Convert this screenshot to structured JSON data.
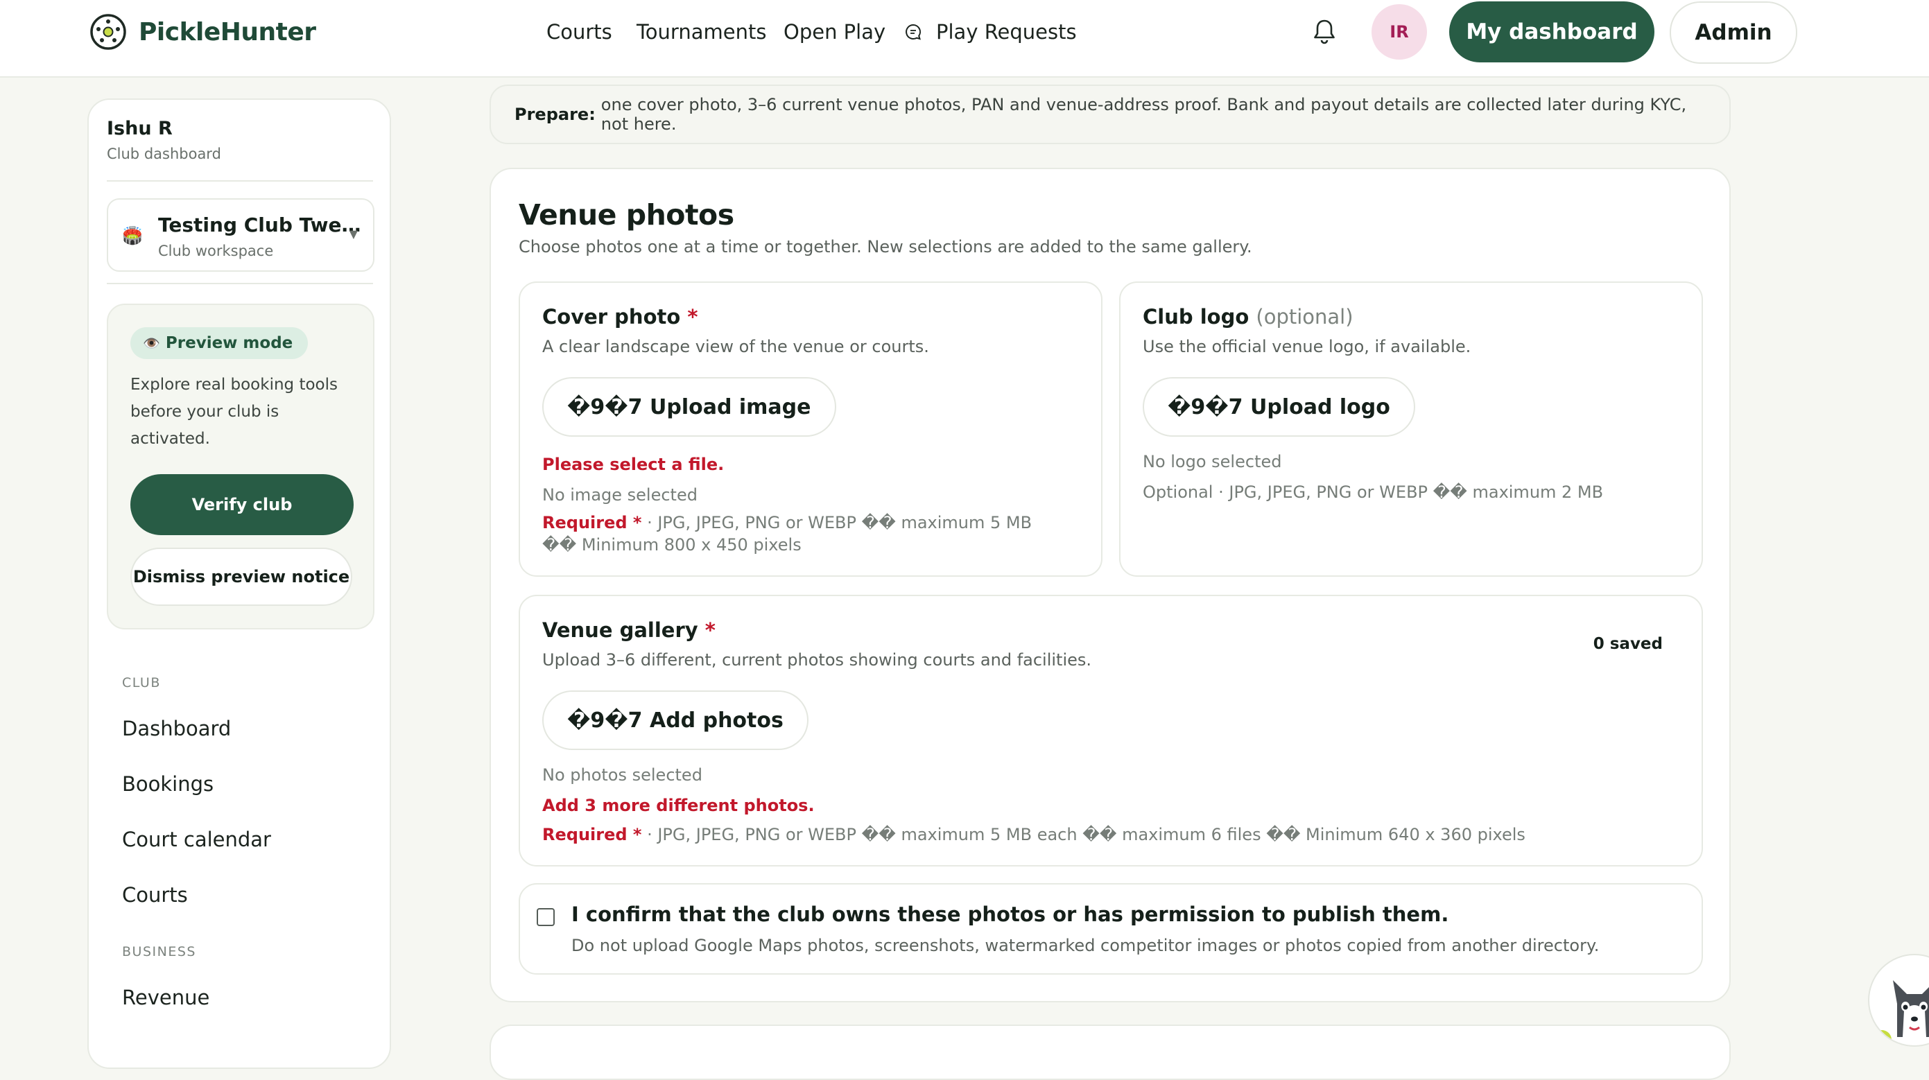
{
  "brand": {
    "name": "PickleHunter"
  },
  "nav": {
    "courts": "Courts",
    "tournaments": "Tournaments",
    "open_play": "Open Play",
    "play_requests": "Play Requests"
  },
  "header": {
    "avatar_initials": "IR",
    "dashboard_label": "My dashboard",
    "admin_label": "Admin"
  },
  "sidebar": {
    "user_name": "Ishu R",
    "user_role": "Club dashboard",
    "club_name": "Testing Club Twe…",
    "club_sub": "Club workspace",
    "preview_badge": "Preview mode",
    "preview_text": "Explore real booking tools before your club is activated.",
    "verify_label": "Verify club",
    "dismiss_label": "Dismiss preview notice",
    "section_club": "CLUB",
    "section_business": "BUSINESS",
    "items": [
      "Dashboard",
      "Bookings",
      "Court calendar",
      "Courts"
    ],
    "business_items": [
      "Revenue"
    ]
  },
  "prepare": {
    "label": "Prepare:",
    "text": "one cover photo, 3–6 current venue photos, PAN and venue-address proof. Bank and payout details are collected later during KYC, not here."
  },
  "venue_photos": {
    "title": "Venue photos",
    "subtitle": "Choose photos one at a time or together. New selections are added to the same gallery.",
    "cover": {
      "title": "Cover photo",
      "required_mark": "*",
      "desc": "A clear landscape view of the venue or courts.",
      "button": "�9�7  Upload image",
      "error": "Please select a file.",
      "status": "No image selected",
      "req_label": "Required *",
      "hint": " · JPG, JPEG, PNG or WEBP �� maximum 5 MB �� Minimum 800 x 450 pixels"
    },
    "logo": {
      "title": "Club logo",
      "optional": "(optional)",
      "desc": "Use the official venue logo, if available.",
      "button": "�9�7  Upload logo",
      "status": "No logo selected",
      "hint": "Optional · JPG, JPEG, PNG or WEBP �� maximum 2 MB"
    },
    "gallery": {
      "title": "Venue gallery",
      "required_mark": "*",
      "desc": "Upload 3–6 different, current photos showing courts and facilities.",
      "saved": "0 saved",
      "button": "�9�7  Add photos",
      "status": "No photos selected",
      "error": "Add 3 more different photos.",
      "req_label": "Required *",
      "hint": " · JPG, JPEG, PNG or WEBP �� maximum 5 MB each �� maximum 6 files �� Minimum 640 x 360 pixels"
    },
    "confirm": {
      "label": "I confirm that the club owns these photos or has permission to publish them.",
      "sub": "Do not upload Google Maps photos, screenshots, watermarked competitor images or photos copied from another directory.",
      "checked": false
    }
  },
  "colors": {
    "brand_green": "#285c45",
    "error_red": "#c2182b",
    "avatar_bg": "#f6dde8",
    "page_bg": "#f6f7f2"
  },
  "icons": [
    "logo-icon",
    "chat-icon",
    "bell-icon",
    "club-icon",
    "eye-icon",
    "caret-down-icon",
    "mascot-icon"
  ]
}
